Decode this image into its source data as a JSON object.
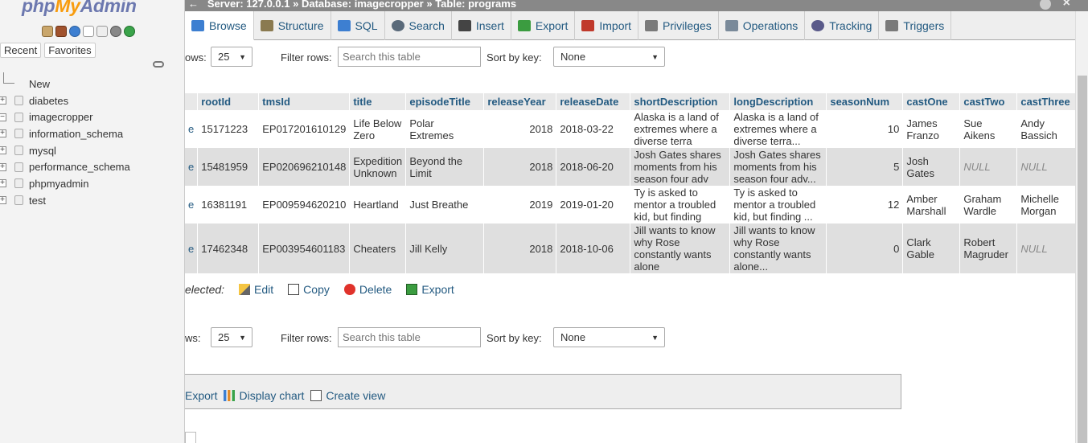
{
  "app": {
    "logo_php": "php",
    "logo_my": "My",
    "logo_admin": "Admin"
  },
  "sidebar": {
    "recent_label": "Recent",
    "favorites_label": "Favorites",
    "tree": [
      {
        "label": "New",
        "expander": ""
      },
      {
        "label": "diabetes",
        "expander": "+"
      },
      {
        "label": "imagecropper",
        "expander": "−"
      },
      {
        "label": "information_schema",
        "expander": "+"
      },
      {
        "label": "mysql",
        "expander": "+"
      },
      {
        "label": "performance_schema",
        "expander": "+"
      },
      {
        "label": "phpmyadmin",
        "expander": "+"
      },
      {
        "label": "test",
        "expander": "+"
      }
    ]
  },
  "breadcrumb": {
    "server": "Server: 127.0.0.1",
    "sep1": "»",
    "database": "Database: imagecropper",
    "sep2": "»",
    "table": "Table: programs"
  },
  "tabs": [
    {
      "label": "Browse",
      "color": "#3d7fd1"
    },
    {
      "label": "Structure",
      "color": "#8a7a50"
    },
    {
      "label": "SQL",
      "color": "#3d7fd1"
    },
    {
      "label": "Search",
      "color": "#5a6a7a"
    },
    {
      "label": "Insert",
      "color": "#444444"
    },
    {
      "label": "Export",
      "color": "#3b9c40"
    },
    {
      "label": "Import",
      "color": "#c0392b"
    },
    {
      "label": "Privileges",
      "color": "#7a7a7a"
    },
    {
      "label": "Operations",
      "color": "#7a8a9a"
    },
    {
      "label": "Tracking",
      "color": "#5a5a8a"
    },
    {
      "label": "Triggers",
      "color": "#7a7a7a"
    }
  ],
  "controls_top": {
    "rows_label": "ows:",
    "rows_value": "25",
    "filter_label": "Filter rows:",
    "filter_placeholder": "Search this table",
    "sort_label": "Sort by key:",
    "sort_value": "None"
  },
  "controls_bottom": {
    "rows_label": "ws:",
    "rows_value": "25",
    "filter_label": "Filter rows:",
    "filter_placeholder": "Search this table",
    "sort_label": "Sort by key:",
    "sort_value": "None"
  },
  "table": {
    "headers": [
      "rootId",
      "tmsId",
      "title",
      "episodeTitle",
      "releaseYear",
      "releaseDate",
      "shortDescription",
      "longDescription",
      "seasonNum",
      "castOne",
      "castTwo",
      "castThree"
    ],
    "rows": [
      {
        "lead": "e",
        "rootId": "15171223",
        "tmsId": "EP017201610129",
        "title": "Life Below Zero",
        "episodeTitle": "Polar Extremes",
        "releaseYear": "2018",
        "releaseDate": "2018-03-22",
        "shortDescription": "Alaska is a land of extremes where a diverse terra",
        "longDescription": "Alaska is a land of extremes where a diverse terra...",
        "seasonNum": "10",
        "castOne": "James Franzo",
        "castTwo": "Sue Aikens",
        "castThree": "Andy Bassich"
      },
      {
        "lead": "e",
        "rootId": "15481959",
        "tmsId": "EP020696210148",
        "title": "Expedition Unknown",
        "episodeTitle": "Beyond the Limit",
        "releaseYear": "2018",
        "releaseDate": "2018-06-20",
        "shortDescription": "Josh Gates shares moments from his season four adv",
        "longDescription": "Josh Gates shares moments from his season four adv...",
        "seasonNum": "5",
        "castOne": "Josh Gates",
        "castTwo": "NULL",
        "castThree": "NULL"
      },
      {
        "lead": "e",
        "rootId": "16381191",
        "tmsId": "EP009594620210",
        "title": "Heartland",
        "episodeTitle": "Just Breathe",
        "releaseYear": "2019",
        "releaseDate": "2019-01-20",
        "shortDescription": "Ty is asked to mentor a troubled kid, but finding",
        "longDescription": "Ty is asked to mentor a troubled kid, but finding ...",
        "seasonNum": "12",
        "castOne": "Amber Marshall",
        "castTwo": "Graham Wardle",
        "castThree": "Michelle Morgan"
      },
      {
        "lead": "e",
        "rootId": "17462348",
        "tmsId": "EP003954601183",
        "title": "Cheaters",
        "episodeTitle": "Jill Kelly",
        "releaseYear": "2018",
        "releaseDate": "2018-10-06",
        "shortDescription": "Jill wants to know why Rose constantly wants alone",
        "longDescription": "Jill wants to know why Rose constantly wants alone...",
        "seasonNum": "0",
        "castOne": "Clark Gable",
        "castTwo": "Robert Magruder",
        "castThree": "NULL"
      }
    ]
  },
  "bulk_actions": {
    "selected_label": "elected:",
    "edit": "Edit",
    "copy": "Copy",
    "delete": "Delete",
    "export": "Export"
  },
  "query_results_ops": {
    "export": "Export",
    "display_chart": "Display chart",
    "create_view": "Create view"
  }
}
